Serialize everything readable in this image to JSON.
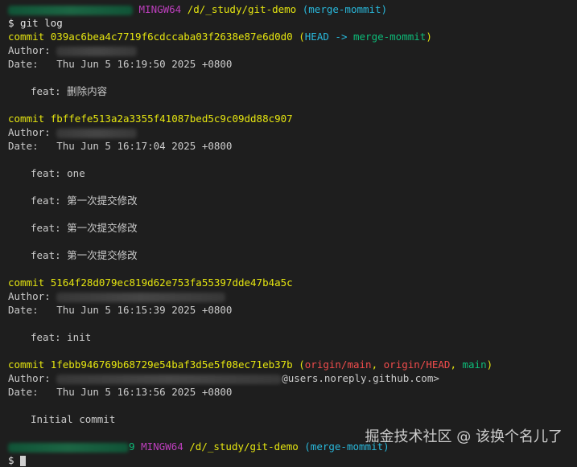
{
  "prompt_top": {
    "shell": "MINGW64",
    "path": "/d/_study/git-demo",
    "branch": "(merge-mommit)"
  },
  "command": "$ git log",
  "commits": [
    {
      "label": "commit",
      "hash": "039ac6bea4c7719f6cdccaba03f2638e87e6d0d0",
      "refs_open": "(",
      "ref1": "HEAD",
      "arrow": " -> ",
      "ref2": "merge-mommit",
      "refs_close": ")",
      "author_label": "Author: ",
      "date_line": "Date:   Thu Jun 5 16:19:50 2025 +0800",
      "messages": [
        "feat: 删除内容"
      ]
    },
    {
      "label": "commit",
      "hash": "fbffefe513a2a3355f41087bed5c9c09dd88c907",
      "author_label": "Author: ",
      "date_line": "Date:   Thu Jun 5 16:17:04 2025 +0800",
      "messages": [
        "feat: one",
        "feat: 第一次提交修改",
        "feat: 第一次提交修改",
        "feat: 第一次提交修改"
      ]
    },
    {
      "label": "commit",
      "hash": "5164f28d079ec819d62e753fa55397dde47b4a5c",
      "author_label": "Author: ",
      "date_line": "Date:   Thu Jun 5 16:15:39 2025 +0800",
      "messages": [
        "feat: init"
      ]
    },
    {
      "label": "commit",
      "hash": "1febb946769b68729e54baf3d5e5f08ec71eb37b",
      "refs_open": "(",
      "ref1": "origin/main",
      "sep1": ", ",
      "ref2": "origin/HEAD",
      "sep2": ", ",
      "ref3": "main",
      "refs_close": ")",
      "author_label": "Author: ",
      "author_tail": "@users.noreply.github.com>",
      "date_line": "Date:   Thu Jun 5 16:13:56 2025 +0800",
      "messages": [
        "Initial commit"
      ]
    }
  ],
  "prompt_bottom": {
    "suffix": "9",
    "shell": "MINGW64",
    "path": "/d/_study/git-demo",
    "branch": "(merge-mommit)",
    "dollar": "$"
  },
  "watermark": "掘金技术社区 @ 该换个名儿了",
  "colors": {
    "background": "#1e1e1e",
    "foreground": "#cccccc",
    "yellow": "#e5e510",
    "cyan": "#29b8db",
    "green": "#0dbc79",
    "red": "#f14c4c",
    "magenta": "#bc3fbc"
  }
}
